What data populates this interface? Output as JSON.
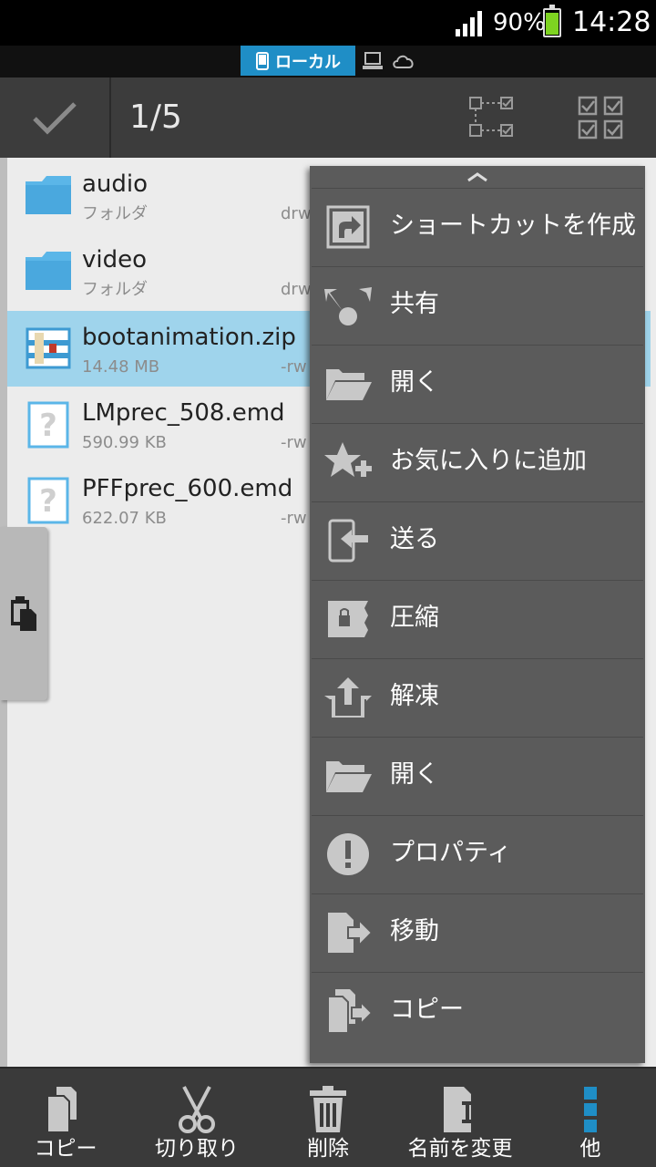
{
  "statusbar": {
    "battery": "90%",
    "time": "14:28"
  },
  "location_tabs": {
    "active_label": "ローカル"
  },
  "actionbar": {
    "selection_count": "1/5"
  },
  "files": [
    {
      "name": "audio",
      "meta": "フォルダ",
      "perm": "drw",
      "type": "folder",
      "selected": false
    },
    {
      "name": "video",
      "meta": "フォルダ",
      "perm": "drw",
      "type": "folder",
      "selected": false
    },
    {
      "name": "bootanimation.zip",
      "meta": "14.48 MB",
      "perm": "-rw",
      "type": "zip",
      "selected": true
    },
    {
      "name": "LMprec_508.emd",
      "meta": "590.99 KB",
      "perm": "-rw",
      "type": "unknown",
      "selected": false
    },
    {
      "name": "PFFprec_600.emd",
      "meta": "622.07 KB",
      "perm": "-rw",
      "type": "unknown",
      "selected": false
    }
  ],
  "menu": {
    "items": [
      {
        "label": "ショートカットを作成",
        "icon": "shortcut-icon"
      },
      {
        "label": "共有",
        "icon": "share-icon"
      },
      {
        "label": "開く",
        "icon": "folder-open-icon"
      },
      {
        "label": "お気に入りに追加",
        "icon": "favorite-add-icon"
      },
      {
        "label": "送る",
        "icon": "send-icon"
      },
      {
        "label": "圧縮",
        "icon": "compress-icon"
      },
      {
        "label": "解凍",
        "icon": "extract-icon"
      },
      {
        "label": "開く",
        "icon": "folder-open-icon"
      },
      {
        "label": "プロパティ",
        "icon": "info-icon"
      },
      {
        "label": "移動",
        "icon": "move-icon"
      },
      {
        "label": "コピー",
        "icon": "copy-icon"
      }
    ]
  },
  "bottombar": {
    "copy": "コピー",
    "cut": "切り取り",
    "delete": "削除",
    "rename": "名前を変更",
    "more": "他"
  },
  "colors": {
    "accent": "#1f8ec6",
    "selected_row": "#9fd4ec",
    "menu_bg": "#5b5b5b"
  }
}
